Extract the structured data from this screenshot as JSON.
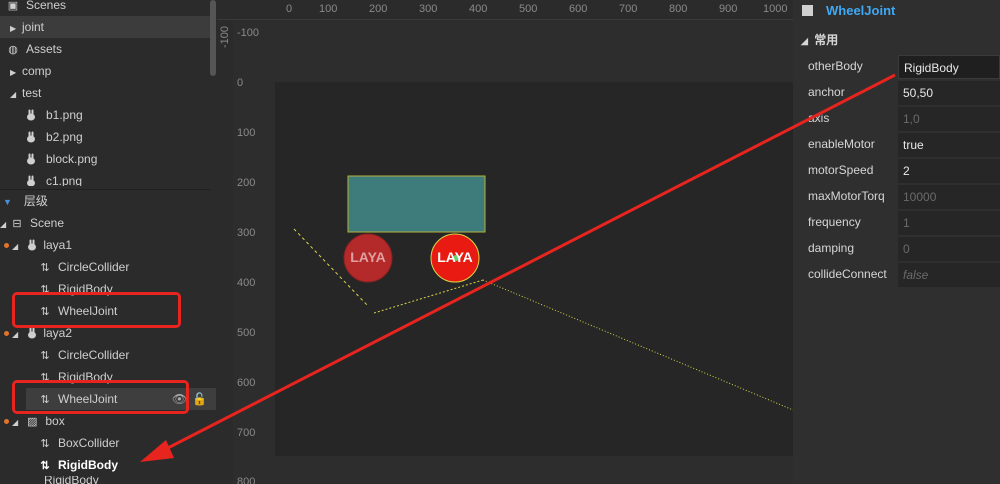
{
  "assets_panel": {
    "scenes_label": "Scenes",
    "scene_joint": "joint",
    "assets_label": "Assets",
    "folder_comp": "comp",
    "folder_test": "test",
    "files": [
      "b1.png",
      "b2.png",
      "block.png",
      "c1.png"
    ]
  },
  "hierarchy": {
    "title": "层级",
    "scene": "Scene",
    "laya1": "laya1",
    "laya1_children": [
      "CircleCollider",
      "RigidBody",
      "WheelJoint"
    ],
    "laya2": "laya2",
    "laya2_children": [
      "CircleCollider",
      "RigidBody",
      "WheelJoint"
    ],
    "box": "box",
    "box_children": [
      "BoxCollider",
      "RigidBody"
    ],
    "cut_item": "RigidBody"
  },
  "ruler": {
    "h_ticks": [
      "0",
      "100",
      "200",
      "300",
      "400",
      "500",
      "600",
      "700",
      "800",
      "900",
      "1000"
    ],
    "v_ticks": [
      "-100",
      "0",
      "100",
      "200",
      "300",
      "400",
      "500",
      "600",
      "700",
      "800"
    ]
  },
  "scene": {
    "ball1_text": "LAYA",
    "ball2_text": "LAYA",
    "box_color": "#3e7b7b",
    "ball1_color": "#b42a2a",
    "ball2_color": "#e81a12"
  },
  "inspector": {
    "component_title": "WheelJoint",
    "section": "常用",
    "props": [
      {
        "label": "otherBody",
        "value": "RigidBody"
      },
      {
        "label": "anchor",
        "value": "50,50"
      },
      {
        "label": "axis",
        "value": "1,0"
      },
      {
        "label": "enableMotor",
        "value": "true"
      },
      {
        "label": "motorSpeed",
        "value": "2"
      },
      {
        "label": "maxMotorTorq",
        "value": "10000"
      },
      {
        "label": "frequency",
        "value": "1"
      },
      {
        "label": "damping",
        "value": "0"
      },
      {
        "label": "collideConnect",
        "value": "false"
      }
    ]
  },
  "colors": {
    "accent": "#3fa9f5",
    "highlight": "#e8241f",
    "joint_line": "#d8d64a"
  }
}
